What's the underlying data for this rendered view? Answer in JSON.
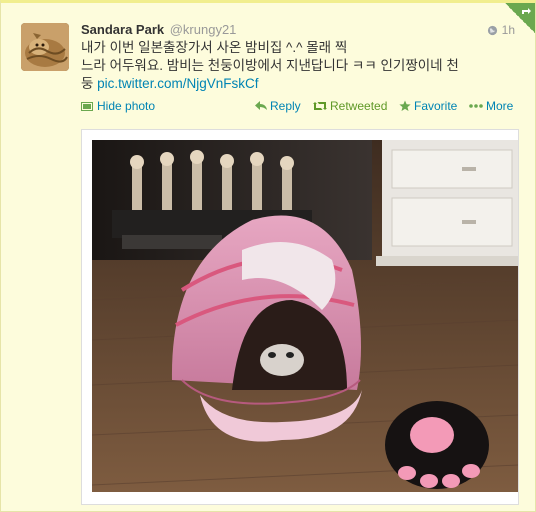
{
  "tweet": {
    "full_name": "Sandara Park",
    "screen_name": "@krungy21",
    "time": "1h",
    "text_line1": "내가 이번 일본출장가서 사온 밤비집 ^.^ 몰래 찍",
    "text_line2": "느라 어두워요. 밤비는 천둥이방에서 지낸답니다 ㅋㅋ 인기짱이네 천",
    "text_line3_prefix": "둥 ",
    "link": "pic.twitter.com/NjgVnFskCf"
  },
  "actions": {
    "hide_photo": "Hide photo",
    "reply": "Reply",
    "retweeted": "Retweeted",
    "favorite": "Favorite",
    "more": "More"
  },
  "colors": {
    "link": "#0084b4",
    "retweeted": "#609928",
    "card_background": "#fdfcdc",
    "card_border": "#f1ee8e"
  },
  "icons": {
    "globe": "globe-icon",
    "photo": "photo-icon",
    "reply": "reply-arrow-icon",
    "retweet": "retweet-icon",
    "favorite": "star-icon",
    "more": "ellipsis-icon",
    "corner": "retweet-corner-icon"
  }
}
